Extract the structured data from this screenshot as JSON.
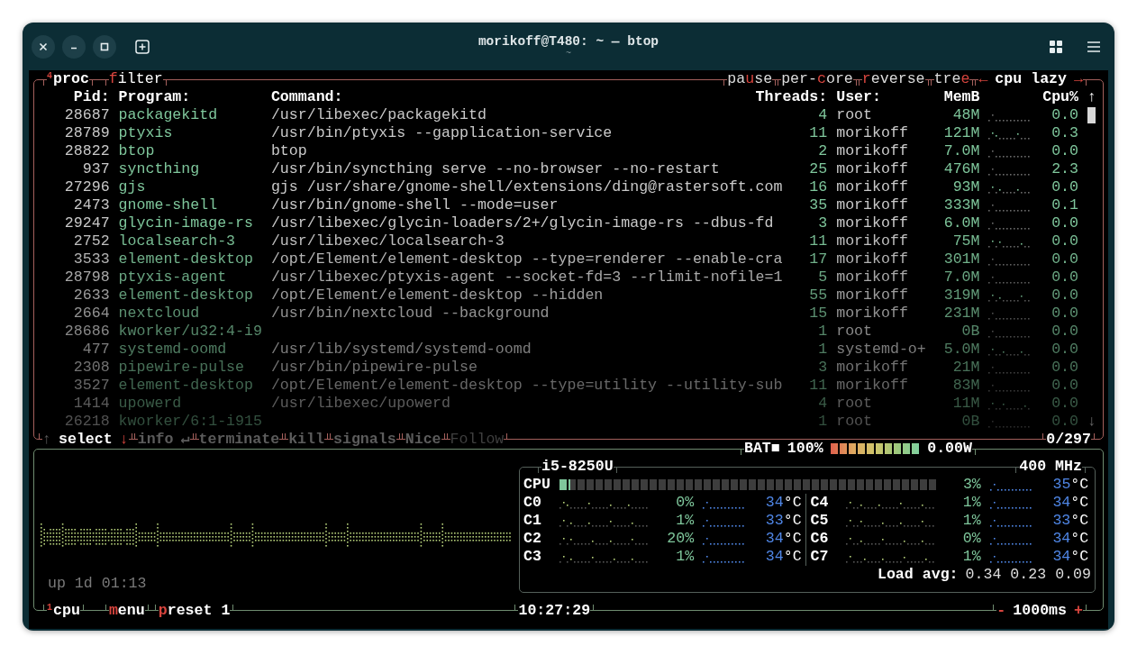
{
  "window": {
    "title": "morikoff@T480: ~ — btop",
    "subtitle": "~"
  },
  "proc_box": {
    "number": "4",
    "title": "proc",
    "options_left": [
      {
        "key": "f",
        "post": "ilter"
      }
    ],
    "options_right": [
      {
        "pre": "pa",
        "key": "u",
        "post": "se"
      },
      {
        "pre": "per-",
        "key": "c",
        "post": "ore"
      },
      {
        "key": "r",
        "post": "everse"
      },
      {
        "pre": "tre",
        "key": "e"
      }
    ],
    "sort": {
      "prev": "←",
      "label": "cpu lazy",
      "next": "→"
    },
    "columns": [
      "Pid:",
      "Program:",
      "Command:",
      "Threads:",
      "User:",
      "MemB",
      "Cpu%"
    ],
    "scroll": {
      "up": "↑",
      "down": "↓"
    },
    "rows": [
      {
        "pid": "28687",
        "program": "packagekitd",
        "command": "/usr/libexec/packagekitd",
        "threads": "4",
        "user": "root",
        "mem": "48M",
        "cpu": "0.0"
      },
      {
        "pid": "28789",
        "program": "ptyxis",
        "command": "/usr/bin/ptyxis --gapplication-service",
        "threads": "11",
        "user": "morikoff",
        "mem": "121M",
        "cpu": "0.3"
      },
      {
        "pid": "28822",
        "program": "btop",
        "command": "btop",
        "threads": "2",
        "user": "morikoff",
        "mem": "7.0M",
        "cpu": "0.0"
      },
      {
        "pid": "937",
        "program": "syncthing",
        "command": "/usr/bin/syncthing serve --no-browser --no-restart",
        "threads": "25",
        "user": "morikoff",
        "mem": "476M",
        "cpu": "2.3"
      },
      {
        "pid": "27296",
        "program": "gjs",
        "command": "gjs /usr/share/gnome-shell/extensions/ding@rastersoft.com",
        "threads": "16",
        "user": "morikoff",
        "mem": "93M",
        "cpu": "0.0"
      },
      {
        "pid": "2473",
        "program": "gnome-shell",
        "command": "/usr/bin/gnome-shell --mode=user",
        "threads": "35",
        "user": "morikoff",
        "mem": "333M",
        "cpu": "0.1"
      },
      {
        "pid": "29247",
        "program": "glycin-image-rs",
        "command": "/usr/libexec/glycin-loaders/2+/glycin-image-rs --dbus-fd",
        "threads": "3",
        "user": "morikoff",
        "mem": "6.0M",
        "cpu": "0.0"
      },
      {
        "pid": "2752",
        "program": "localsearch-3",
        "command": "/usr/libexec/localsearch-3",
        "threads": "11",
        "user": "morikoff",
        "mem": "75M",
        "cpu": "0.0"
      },
      {
        "pid": "3533",
        "program": "element-desktop",
        "command": "/opt/Element/element-desktop --type=renderer --enable-cra",
        "threads": "17",
        "user": "morikoff",
        "mem": "301M",
        "cpu": "0.0"
      },
      {
        "pid": "28798",
        "program": "ptyxis-agent",
        "command": "/usr/libexec/ptyxis-agent --socket-fd=3 --rlimit-nofile=1",
        "threads": "5",
        "user": "morikoff",
        "mem": "7.0M",
        "cpu": "0.0"
      },
      {
        "pid": "2633",
        "program": "element-desktop",
        "command": "/opt/Element/element-desktop --hidden",
        "threads": "55",
        "user": "morikoff",
        "mem": "319M",
        "cpu": "0.0"
      },
      {
        "pid": "2664",
        "program": "nextcloud",
        "command": "/usr/bin/nextcloud --background",
        "threads": "15",
        "user": "morikoff",
        "mem": "231M",
        "cpu": "0.0"
      },
      {
        "pid": "28686",
        "program": "kworker/u32:4-i9",
        "threads": "1",
        "user": "root",
        "mem": "0B",
        "cpu": "0.0"
      },
      {
        "pid": "477",
        "program": "systemd-oomd",
        "command": "/usr/lib/systemd/systemd-oomd",
        "threads": "1",
        "user": "systemd-o+",
        "mem": "5.0M",
        "cpu": "0.0"
      },
      {
        "pid": "2308",
        "program": "pipewire-pulse",
        "command": "/usr/bin/pipewire-pulse",
        "threads": "3",
        "user": "morikoff",
        "mem": "21M",
        "cpu": "0.0"
      },
      {
        "pid": "3527",
        "program": "element-desktop",
        "command": "/opt/Element/element-desktop --type=utility --utility-sub",
        "threads": "11",
        "user": "morikoff",
        "mem": "83M",
        "cpu": "0.0"
      },
      {
        "pid": "1414",
        "program": "upowerd",
        "command": "/usr/libexec/upowerd",
        "threads": "4",
        "user": "root",
        "mem": "11M",
        "cpu": "0.0"
      },
      {
        "pid": "26218",
        "program": "kworker/6:1-i915",
        "threads": "1",
        "user": "root",
        "mem": "0B",
        "cpu": "0.0"
      }
    ],
    "actions": [
      {
        "prefix": "↑",
        "label": "select",
        "suffix": "↓",
        "kind": "key",
        "disabled": false
      },
      {
        "label": "info",
        "suffix": "↵",
        "kind": "key",
        "disabled": true
      },
      {
        "label": "terminate",
        "kind": "key",
        "disabled": true
      },
      {
        "label": "kill",
        "kind": "key",
        "disabled": true
      },
      {
        "label": "signals",
        "kind": "key",
        "disabled": true
      },
      {
        "label": "Nice",
        "kind": "key",
        "disabled": true
      },
      {
        "label": "Follow",
        "kind": "toggle",
        "disabled": true
      }
    ],
    "count": "0/297"
  },
  "battery": {
    "label": "BAT■",
    "percent": "100%",
    "level": 1,
    "power": "0.00W"
  },
  "cpu_box": {
    "number": "1",
    "title": "cpu",
    "options": [
      {
        "key": "m",
        "post": "enu"
      },
      {
        "key": "p",
        "post": "reset 1"
      }
    ],
    "clock": "10:27:29",
    "interval": {
      "minus": "-",
      "value": "1000ms",
      "plus": "+"
    },
    "uptime": "up 1d 01:13",
    "model": "i5-8250U",
    "freq": "400 MHz",
    "total": {
      "label": "CPU",
      "level": 0.03,
      "percent": "3%",
      "temp": "35",
      "unit": "°C"
    },
    "cores": [
      {
        "label": "C0",
        "percent": "0%",
        "temp": "34",
        "unit": "°C"
      },
      {
        "label": "C1",
        "percent": "1%",
        "temp": "33",
        "unit": "°C"
      },
      {
        "label": "C2",
        "percent": "20%",
        "temp": "34",
        "unit": "°C"
      },
      {
        "label": "C3",
        "percent": "1%",
        "temp": "34",
        "unit": "°C"
      },
      {
        "label": "C4",
        "percent": "1%",
        "temp": "34",
        "unit": "°C"
      },
      {
        "label": "C5",
        "percent": "1%",
        "temp": "33",
        "unit": "°C"
      },
      {
        "label": "C6",
        "percent": "0%",
        "temp": "34",
        "unit": "°C"
      },
      {
        "label": "C7",
        "percent": "1%",
        "temp": "34",
        "unit": "°C"
      }
    ],
    "load": {
      "label": "Load avg:",
      "values": "0.34 0.23 0.09"
    }
  }
}
